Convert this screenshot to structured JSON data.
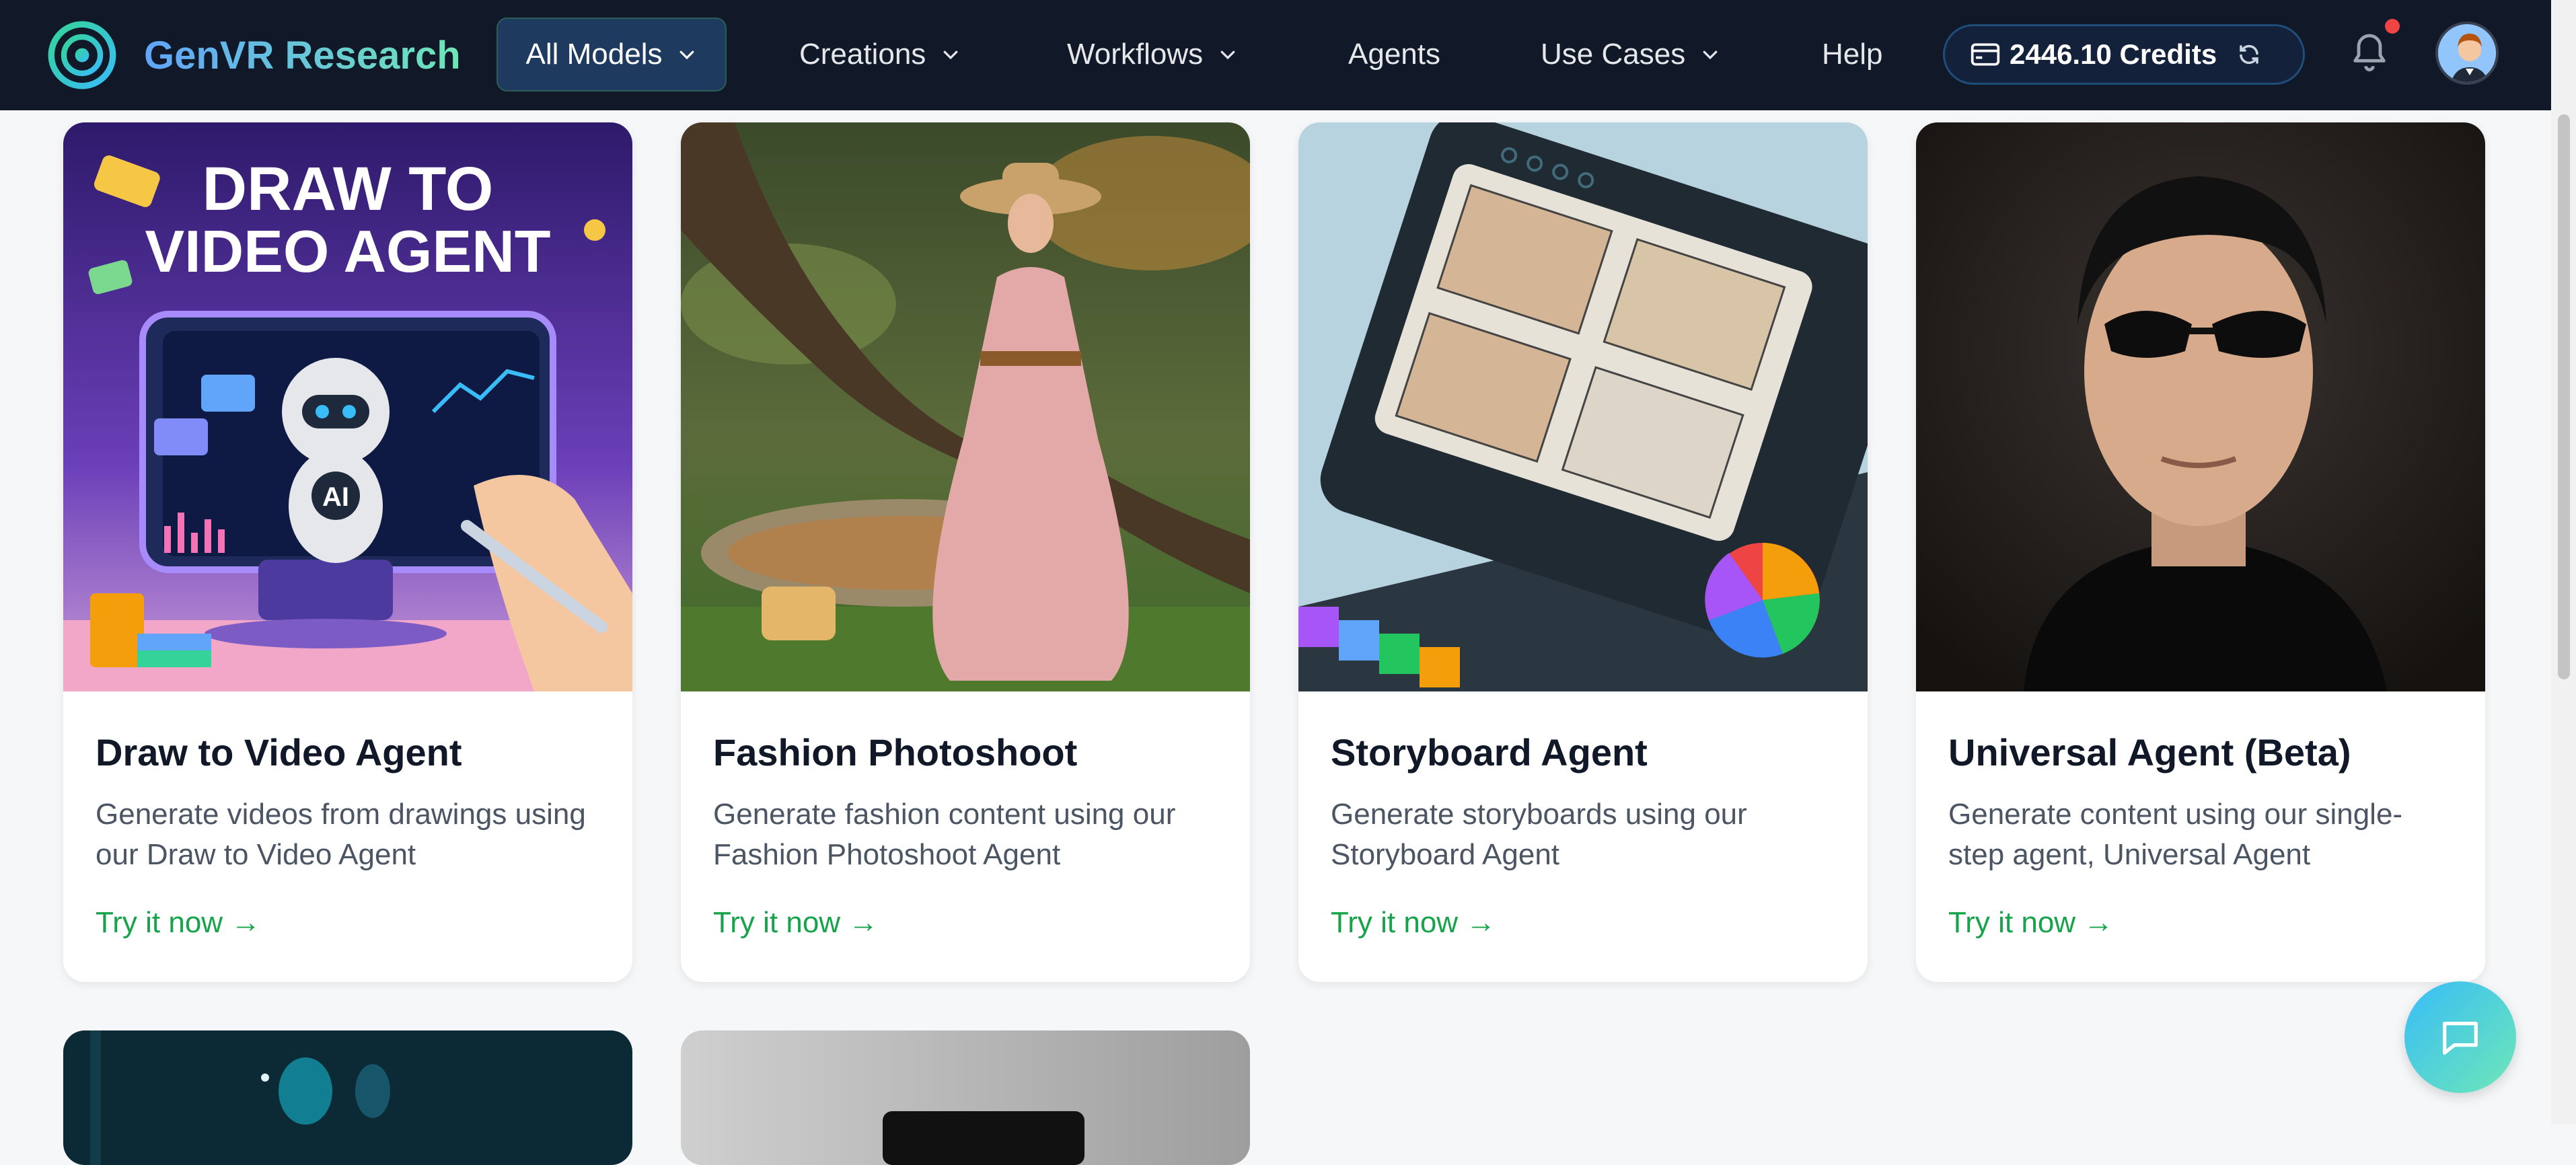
{
  "brand": {
    "name": "GenVR Research"
  },
  "nav": {
    "all_models": "All Models",
    "creations": "Creations",
    "workflows": "Workflows",
    "agents": "Agents",
    "use_cases": "Use Cases",
    "help": "Help"
  },
  "credits": {
    "label": "2446.10 Credits"
  },
  "thumb_text": {
    "draw_title_line1": "DRAW TO",
    "draw_title_line2": "VIDEO AGENT",
    "ai_badge": "AI"
  },
  "cards": [
    {
      "title": "Draw to Video Agent",
      "description": "Generate videos from drawings using our Draw to Video Agent",
      "cta": "Try it now →"
    },
    {
      "title": "Fashion Photoshoot",
      "description": "Generate fashion content using our Fashion Photoshoot Agent",
      "cta": "Try it now →"
    },
    {
      "title": "Storyboard Agent",
      "description": "Generate storyboards using our Storyboard Agent",
      "cta": "Try it now →"
    },
    {
      "title": "Universal Agent (Beta)",
      "description": "Generate content using our single-step agent, Universal Agent",
      "cta": "Try it now →"
    }
  ],
  "colors": {
    "nav_bg": "#111827",
    "accent_green": "#16a34a",
    "card_bg": "#ffffff"
  }
}
